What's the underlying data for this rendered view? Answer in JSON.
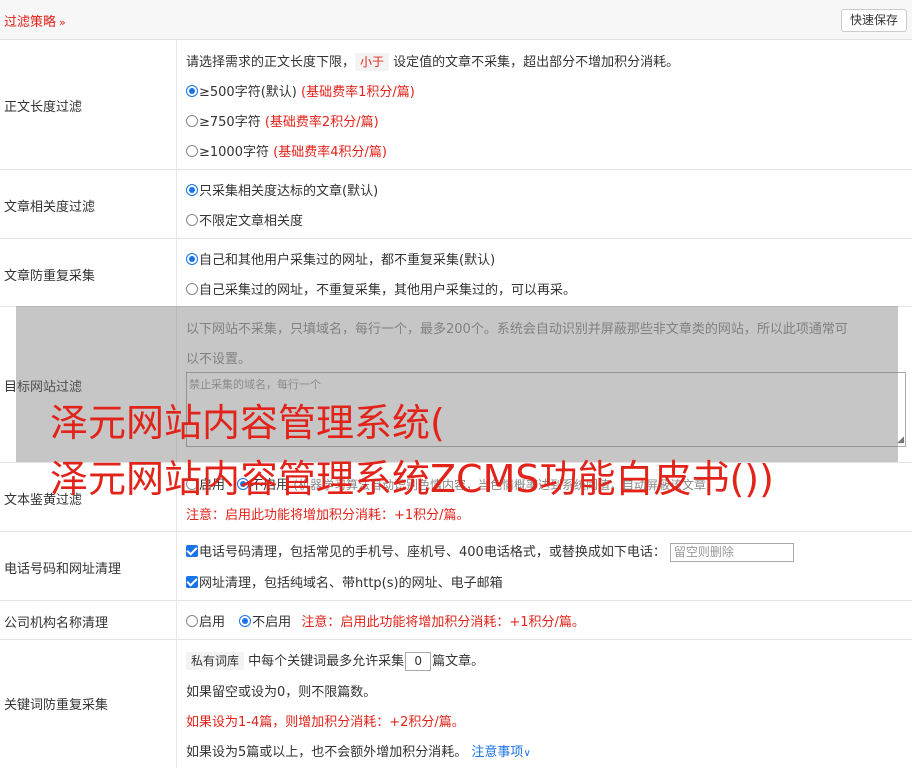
{
  "header": {
    "title": "过滤策略",
    "chevron_icon": "double-chevron-down-icon",
    "save_label": "快速保存"
  },
  "sections": {
    "length": {
      "label": "正文长度过滤",
      "desc_before": "请选择需求的正文长度下限，",
      "tag": "小于",
      "desc_after": "设定值的文章不采集，超出部分不增加积分消耗。",
      "options": [
        {
          "text": "≥500字符(默认)",
          "note": "(基础费率1积分/篇)",
          "checked": true
        },
        {
          "text": "≥750字符",
          "note": "(基础费率2积分/篇)",
          "checked": false
        },
        {
          "text": "≥1000字符",
          "note": "(基础费率4积分/篇)",
          "checked": false
        }
      ]
    },
    "relevance": {
      "label": "文章相关度过滤",
      "options": [
        {
          "text": "只采集相关度达标的文章(默认)",
          "checked": true
        },
        {
          "text": "不限定文章相关度",
          "checked": false
        }
      ]
    },
    "dedupe": {
      "label": "文章防重复采集",
      "options": [
        {
          "text": "自己和其他用户采集过的网址，都不重复采集(默认)",
          "checked": true
        },
        {
          "text": "自己采集过的网址，不重复采集，其他用户采集过的，可以再采。",
          "checked": false
        }
      ]
    },
    "sites": {
      "label": "目标网站过滤",
      "desc_line1": "以下网站不采集，只填域名，每行一个，最多200个。系统会自动识别并屏蔽那些非文章类的网站，所以此项通常可",
      "desc_line2": "以不设置。",
      "placeholder": "禁止采集的域名，每行一个"
    },
    "porn": {
      "label": "文本鉴黄过滤",
      "option_on": "启用",
      "option_off": "不启用",
      "desc": "(机器学习算法自动识别色情内容，当色情概率达到系统阈值，自动屏蔽该文章)",
      "note": "注意：启用此功能将增加积分消耗：+1积分/篇。"
    },
    "phone": {
      "label": "电话号码和网址清理",
      "phone_text": "电话号码清理，包括常见的手机号、座机号、400电话格式，或替换成如下电话：",
      "phone_placeholder": "留空则删除",
      "url_text": "网址清理，包括纯域名、带http(s)的网址、电子邮箱"
    },
    "company": {
      "label": "公司机构名称清理",
      "option_on": "启用",
      "option_off": "不启用",
      "note": "注意：启用此功能将增加积分消耗：+1积分/篇。"
    },
    "keyword": {
      "label": "关键词防重复采集",
      "tag": "私有词库",
      "text_before": "中每个关键词最多允许采集",
      "value": "0",
      "text_after": "篇文章。",
      "line2": "如果留空或设为0，则不限篇数。",
      "line3": "如果设为1-4篇，则增加积分消耗：+2积分/篇。",
      "line4": "如果设为5篇或以上，也不会额外增加积分消耗。",
      "link": "注意事项",
      "link_icon": "chevron-down-icon"
    }
  },
  "watermark": {
    "line1": "泽元网站内容管理系统(",
    "line2": "泽元网站内容管理系统ZCMS功能白皮书())"
  },
  "colors": {
    "accent": "#e2231a",
    "link": "#1a73e8",
    "overlay": "#8a8a8a"
  }
}
